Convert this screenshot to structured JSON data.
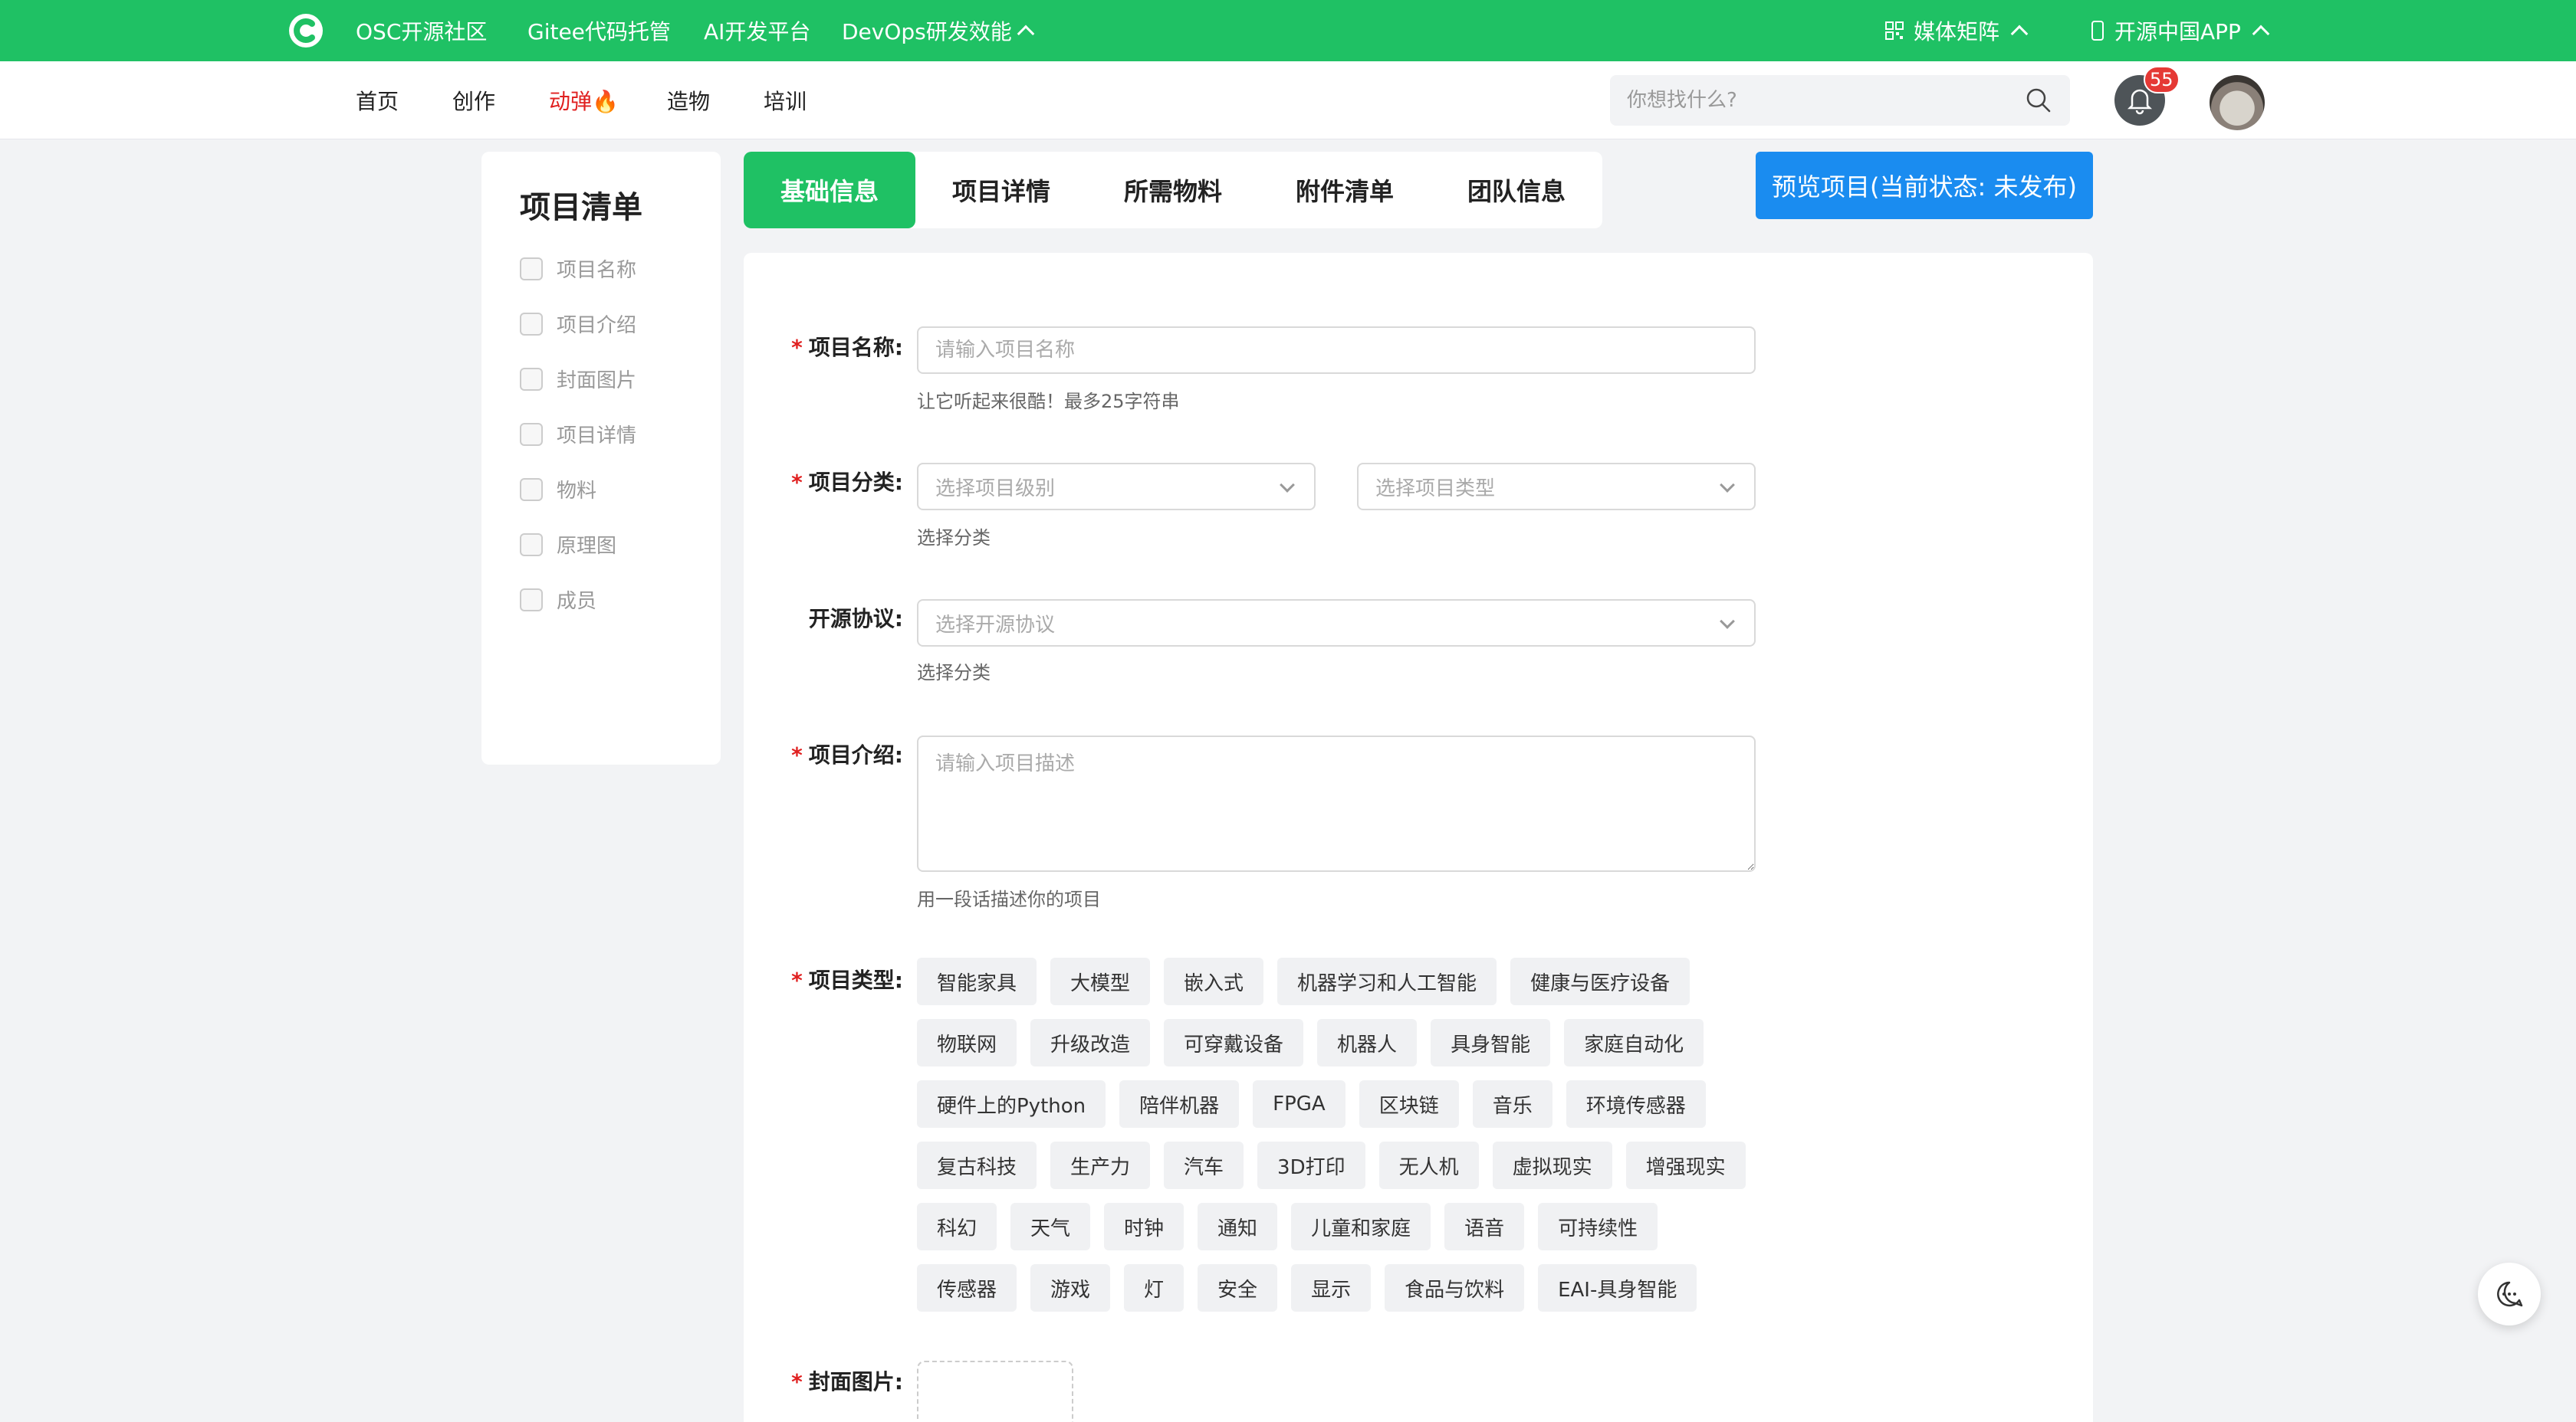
{
  "topbar": {
    "links": [
      "OSC开源社区",
      "Gitee代码托管",
      "AI开发平台",
      "DevOps研发效能"
    ],
    "media": "媒体矩阵",
    "app": "开源中国APP"
  },
  "subnav": {
    "items": [
      "首页",
      "创作",
      "动弹🔥",
      "造物",
      "培训"
    ],
    "search_placeholder": "你想找什么?",
    "notification_count": "55"
  },
  "checklist": {
    "title": "项目清单",
    "items": [
      "项目名称",
      "项目介绍",
      "封面图片",
      "项目详情",
      "物料",
      "原理图",
      "成员"
    ]
  },
  "tabs": [
    "基础信息",
    "项目详情",
    "所需物料",
    "附件清单",
    "团队信息"
  ],
  "preview_button": "预览项目(当前状态: 未发布)",
  "form": {
    "name_label": "项目名称:",
    "name_placeholder": "请输入项目名称",
    "name_hint": "让它听起来很酷！最多25字符串",
    "category_label": "项目分类:",
    "level_placeholder": "选择项目级别",
    "type_select_placeholder": "选择项目类型",
    "category_hint": "选择分类",
    "license_label": "开源协议:",
    "license_placeholder": "选择开源协议",
    "license_hint": "选择分类",
    "intro_label": "项目介绍:",
    "intro_placeholder": "请输入项目描述",
    "intro_hint": "用一段话描述你的项目",
    "type_label": "项目类型:",
    "cover_label": "封面图片:",
    "tags": [
      [
        "智能家具",
        "大模型",
        "嵌入式",
        "机器学习和人工智能",
        "健康与医疗设备"
      ],
      [
        "物联网",
        "升级改造",
        "可穿戴设备",
        "机器人",
        "具身智能",
        "家庭自动化"
      ],
      [
        "硬件上的Python",
        "陪伴机器",
        "FPGA",
        "区块链",
        "音乐",
        "环境传感器"
      ],
      [
        "复古科技",
        "生产力",
        "汽车",
        "3D打印",
        "无人机",
        "虚拟现实",
        "增强现实"
      ],
      [
        "科幻",
        "天气",
        "时钟",
        "通知",
        "儿童和家庭",
        "语音",
        "可持续性"
      ],
      [
        "传感器",
        "游戏",
        "灯",
        "安全",
        "显示",
        "食品与饮料",
        "EAI-具身智能"
      ]
    ]
  }
}
